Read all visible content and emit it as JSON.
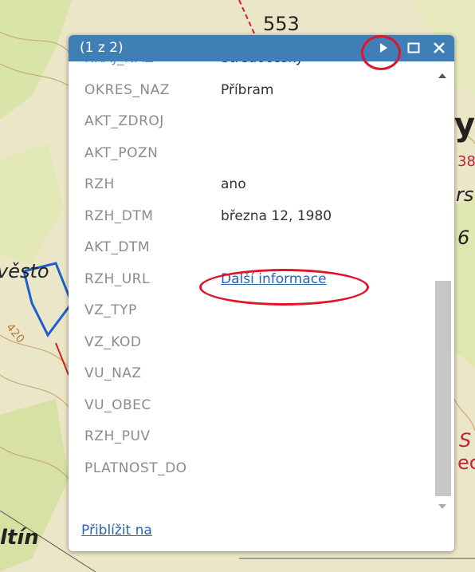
{
  "map": {
    "labels": [
      "553",
      "ys",
      "38",
      "rs",
      "6",
      "věsto",
      "420",
      "ltín",
      "S",
      "ec"
    ]
  },
  "popup": {
    "title": "(1 z 2)",
    "next_icon": "play-triangle",
    "maximize_icon": "square-outline",
    "close_icon": "x",
    "fields": [
      {
        "key": "KRAJ_NAZ",
        "value": "Středočeský"
      },
      {
        "key": "OKRES_NAZ",
        "value": "Příbram"
      },
      {
        "key": "AKT_ZDROJ",
        "value": ""
      },
      {
        "key": "AKT_POZN",
        "value": ""
      },
      {
        "key": "RZH",
        "value": "ano"
      },
      {
        "key": "RZH_DTM",
        "value": "března 12, 1980"
      },
      {
        "key": "AKT_DTM",
        "value": ""
      },
      {
        "key": "RZH_URL",
        "value": "Další informace",
        "link": true
      },
      {
        "key": "VZ_TYP",
        "value": ""
      },
      {
        "key": "VZ_KOD",
        "value": ""
      },
      {
        "key": "VU_NAZ",
        "value": ""
      },
      {
        "key": "VU_OBEC",
        "value": ""
      },
      {
        "key": "RZH_PUV",
        "value": ""
      },
      {
        "key": "PLATNOST_DO",
        "value": ""
      }
    ],
    "footer": {
      "zoom_link": "Přiblížit na"
    }
  },
  "colors": {
    "titlebar": "#3f7fb6",
    "link": "#2a62b4",
    "highlight": "#e0152a"
  }
}
